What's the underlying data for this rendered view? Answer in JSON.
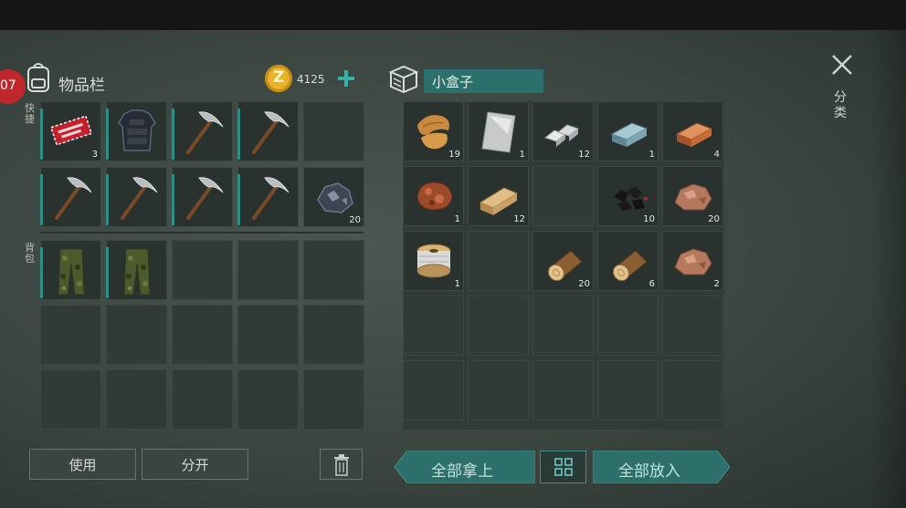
{
  "top_badge": "07",
  "left_panel": {
    "title": "物品栏",
    "coins": "4125",
    "hotbar_label": "快捷",
    "backpack_label": "背包",
    "hotbar": [
      {
        "icon": "coupon-icon",
        "count": "3"
      },
      {
        "icon": "armor-vest-icon",
        "count": ""
      },
      {
        "icon": "pickaxe-icon",
        "count": ""
      },
      {
        "icon": "pickaxe-icon",
        "count": ""
      },
      {
        "icon": "",
        "count": ""
      },
      {
        "icon": "pickaxe-icon",
        "count": ""
      },
      {
        "icon": "pickaxe-icon",
        "count": ""
      },
      {
        "icon": "pickaxe-icon",
        "count": ""
      },
      {
        "icon": "pickaxe-icon",
        "count": ""
      },
      {
        "icon": "ore-rock-icon",
        "count": "20"
      }
    ],
    "backpack": [
      {
        "icon": "camo-pants-icon",
        "count": ""
      },
      {
        "icon": "camo-pants-icon",
        "count": ""
      },
      {
        "icon": "",
        "count": ""
      },
      {
        "icon": "",
        "count": ""
      },
      {
        "icon": "",
        "count": ""
      },
      {
        "icon": "",
        "count": ""
      },
      {
        "icon": "",
        "count": ""
      },
      {
        "icon": "",
        "count": ""
      },
      {
        "icon": "",
        "count": ""
      },
      {
        "icon": "",
        "count": ""
      },
      {
        "icon": "",
        "count": ""
      },
      {
        "icon": "",
        "count": ""
      },
      {
        "icon": "",
        "count": ""
      },
      {
        "icon": "",
        "count": ""
      },
      {
        "icon": "",
        "count": ""
      }
    ],
    "use_label": "使用",
    "split_label": "分开"
  },
  "right_panel": {
    "title": "小盒子",
    "side_label": "分类",
    "slots": [
      {
        "icon": "fiber-icon",
        "count": "19"
      },
      {
        "icon": "metal-sheet-icon",
        "count": "1"
      },
      {
        "icon": "silver-ingot-icon",
        "count": "12"
      },
      {
        "icon": "steel-ingot-icon",
        "count": "1"
      },
      {
        "icon": "copper-ingot-icon",
        "count": "4"
      },
      {
        "icon": "raw-meat-icon",
        "count": "1"
      },
      {
        "icon": "wood-plank-icon",
        "count": "12"
      },
      {
        "icon": "",
        "count": ""
      },
      {
        "icon": "coal-icon",
        "count": "10"
      },
      {
        "icon": "copper-ore-icon",
        "count": "20"
      },
      {
        "icon": "wire-spool-icon",
        "count": "1"
      },
      {
        "icon": "",
        "count": ""
      },
      {
        "icon": "log-icon",
        "count": "20"
      },
      {
        "icon": "log-icon",
        "count": "6"
      },
      {
        "icon": "copper-ore-icon",
        "count": "2"
      },
      {
        "icon": "",
        "count": ""
      },
      {
        "icon": "",
        "count": ""
      },
      {
        "icon": "",
        "count": ""
      },
      {
        "icon": "",
        "count": ""
      },
      {
        "icon": "",
        "count": ""
      },
      {
        "icon": "",
        "count": ""
      },
      {
        "icon": "",
        "count": ""
      },
      {
        "icon": "",
        "count": ""
      },
      {
        "icon": "",
        "count": ""
      },
      {
        "icon": "",
        "count": ""
      }
    ],
    "take_all_label": "全部拿上",
    "put_all_label": "全部放入"
  },
  "colors": {
    "accent_teal": "#2f8c86",
    "button_teal": "#2c6f6b",
    "badge_red": "#c0272d",
    "coin_gold": "#e8b22c"
  }
}
